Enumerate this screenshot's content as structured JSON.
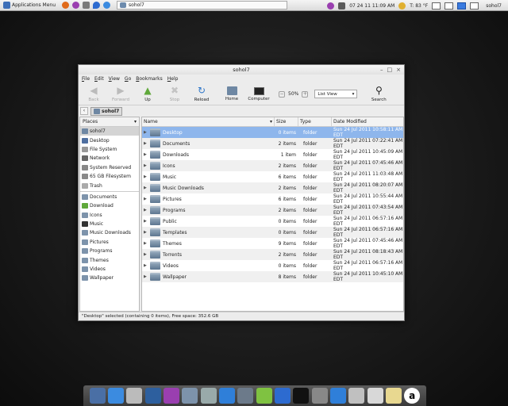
{
  "panel": {
    "apps_menu": "Applications Menu",
    "launchers": [
      "firefox-icon",
      "chat-icon",
      "gear-icon",
      "drop-icon",
      "browser-icon"
    ],
    "task_title": "sohol7",
    "clock": "07 24 11  11:09 AM",
    "temperature": "T: 83 °F",
    "user": "sohol7"
  },
  "window": {
    "title": "sohol7",
    "menu": [
      "File",
      "Edit",
      "View",
      "Go",
      "Bookmarks",
      "Help"
    ],
    "toolbar": {
      "back": "Back",
      "forward": "Forward",
      "up": "Up",
      "stop": "Stop",
      "reload": "Reload",
      "home": "Home",
      "computer": "Computer",
      "zoom": "50%",
      "view_mode": "List View",
      "search": "Search"
    },
    "path": "sohol7",
    "sidebar": {
      "header": "Places",
      "places": [
        "sohol7",
        "Desktop",
        "File System",
        "Network",
        "System Reserved",
        "65 GB Filesystem",
        "Trash"
      ],
      "bookmarks": [
        "Documents",
        "Download",
        "Icons",
        "Music",
        "Music Downloads",
        "Pictures",
        "Programs",
        "Themes",
        "Videos",
        "Wallpaper"
      ]
    },
    "columns": {
      "name": "Name",
      "size": "Size",
      "type": "Type",
      "date": "Date Modified"
    },
    "files": [
      {
        "name": "Desktop",
        "size": "0 items",
        "type": "folder",
        "date": "Sun 24 Jul 2011 10:58:11 AM EDT",
        "selected": true
      },
      {
        "name": "Documents",
        "size": "2 items",
        "type": "folder",
        "date": "Sun 24 Jul 2011 07:22:41 AM EDT"
      },
      {
        "name": "Downloads",
        "size": "1 item",
        "type": "folder",
        "date": "Sun 24 Jul 2011 10:45:09 AM EDT"
      },
      {
        "name": "Icons",
        "size": "2 items",
        "type": "folder",
        "date": "Sun 24 Jul 2011 07:45:46 AM EDT"
      },
      {
        "name": "Music",
        "size": "6 items",
        "type": "folder",
        "date": "Sun 24 Jul 2011 11:03:48 AM EDT"
      },
      {
        "name": "Music Downloads",
        "size": "2 items",
        "type": "folder",
        "date": "Sun 24 Jul 2011 08:20:07 AM EDT"
      },
      {
        "name": "Pictures",
        "size": "6 items",
        "type": "folder",
        "date": "Sun 24 Jul 2011 10:55:44 AM EDT"
      },
      {
        "name": "Programs",
        "size": "2 items",
        "type": "folder",
        "date": "Sun 24 Jul 2011 07:43:54 AM EDT"
      },
      {
        "name": "Public",
        "size": "0 items",
        "type": "folder",
        "date": "Sun 24 Jul 2011 06:57:16 AM EDT"
      },
      {
        "name": "Templates",
        "size": "0 items",
        "type": "folder",
        "date": "Sun 24 Jul 2011 06:57:16 AM EDT"
      },
      {
        "name": "Themes",
        "size": "9 items",
        "type": "folder",
        "date": "Sun 24 Jul 2011 07:45:46 AM EDT"
      },
      {
        "name": "Torrents",
        "size": "2 items",
        "type": "folder",
        "date": "Sun 24 Jul 2011 08:18:43 AM EDT"
      },
      {
        "name": "Videos",
        "size": "0 items",
        "type": "folder",
        "date": "Sun 24 Jul 2011 06:57:16 AM EDT"
      },
      {
        "name": "Wallpaper",
        "size": "8 items",
        "type": "folder",
        "date": "Sun 24 Jul 2011 10:45:10 AM EDT"
      }
    ],
    "status": "\"Desktop\" selected (containing 0 items), Free space: 352.6 GB"
  },
  "dock": [
    "monitor-icon",
    "browser-icon",
    "drive-icon",
    "globe-icon",
    "chat-icon",
    "folder-icon",
    "tools-icon",
    "download-icon",
    "editor-icon",
    "music-icon",
    "drop-icon",
    "terminal-icon",
    "search-icon",
    "download-icon",
    "trash-icon",
    "camera-icon",
    "speaker-icon",
    "a-icon"
  ]
}
